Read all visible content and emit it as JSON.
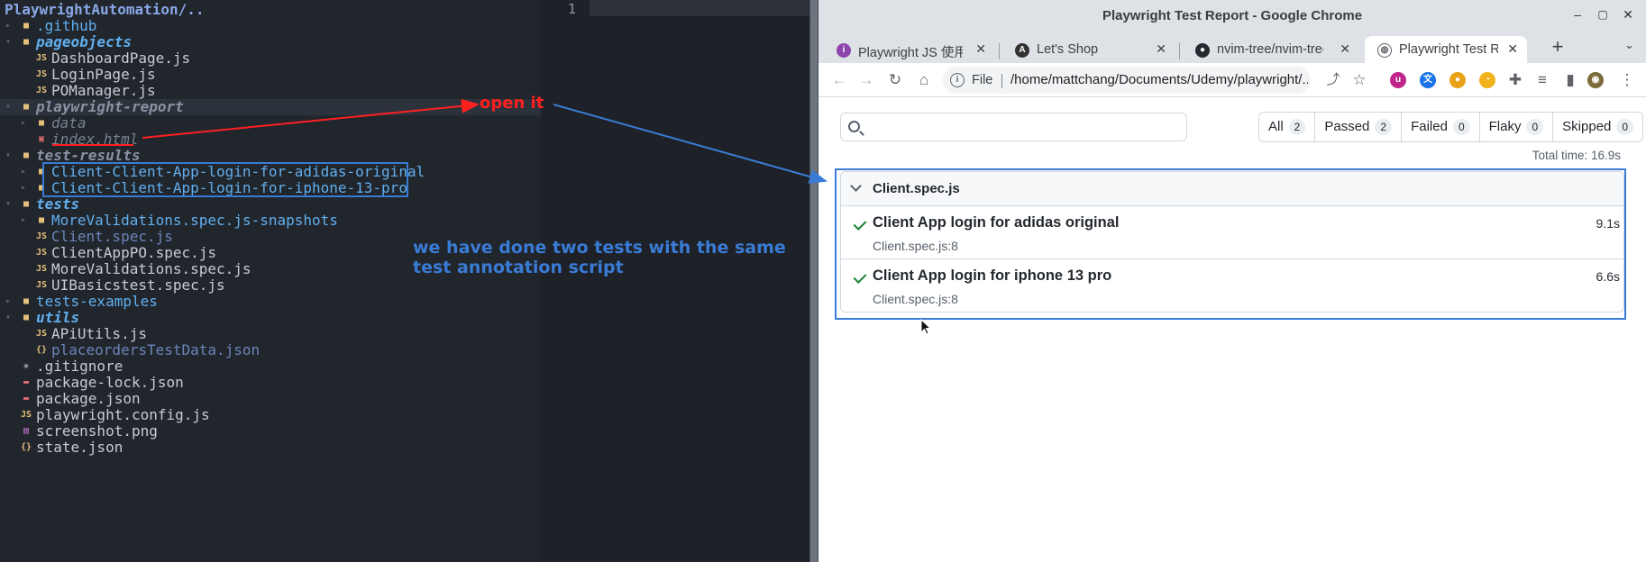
{
  "tree": {
    "root_title": "PlaywrightAutomation/..",
    "rows": [
      {
        "name": ".github",
        "kind": "dir"
      },
      {
        "name": "pageobjects",
        "kind": "opendir"
      },
      {
        "name": "DashboardPage.js",
        "kind": "js"
      },
      {
        "name": "LoginPage.js",
        "kind": "js"
      },
      {
        "name": "POManager.js",
        "kind": "js"
      },
      {
        "name": "playwright-report",
        "kind": "ignored-opendir"
      },
      {
        "name": "data",
        "kind": "ignored-dir"
      },
      {
        "name": "index.html",
        "kind": "ignored-html"
      },
      {
        "name": "test-results",
        "kind": "ignored-opendir"
      },
      {
        "name": "Client-Client-App-login-for-adidas-original",
        "kind": "dir"
      },
      {
        "name": "Client-Client-App-login-for-iphone-13-pro",
        "kind": "dir"
      },
      {
        "name": "tests",
        "kind": "opendir"
      },
      {
        "name": "MoreValidations.spec.js-snapshots",
        "kind": "dir"
      },
      {
        "name": "Client.spec.js",
        "kind": "js-git"
      },
      {
        "name": "ClientAppPO.spec.js",
        "kind": "js"
      },
      {
        "name": "MoreValidations.spec.js",
        "kind": "js"
      },
      {
        "name": "UIBasicstest.spec.js",
        "kind": "js"
      },
      {
        "name": "tests-examples",
        "kind": "dir"
      },
      {
        "name": "utils",
        "kind": "opendir"
      },
      {
        "name": "APiUtils.js",
        "kind": "js"
      },
      {
        "name": "placeordersTestData.json",
        "kind": "json-git"
      },
      {
        "name": ".gitignore",
        "kind": "git"
      },
      {
        "name": "package-lock.json",
        "kind": "npm"
      },
      {
        "name": "package.json",
        "kind": "npm"
      },
      {
        "name": "playwright.config.js",
        "kind": "js"
      },
      {
        "name": "screenshot.png",
        "kind": "img"
      },
      {
        "name": "state.json",
        "kind": "json"
      }
    ]
  },
  "editor": {
    "line_number": "1"
  },
  "browser": {
    "window_title": "Playwright Test Report - Google Chrome",
    "tabs": [
      {
        "title": "Playwright JS 使用",
        "favicon": "purple-circle-icon"
      },
      {
        "title": "Let's Shop",
        "favicon": "angular-icon"
      },
      {
        "title": "nvim-tree/nvim-tree",
        "favicon": "github-icon"
      },
      {
        "title": "Playwright Test Rep",
        "favicon": "globe-icon",
        "active": true
      }
    ],
    "address_scheme": "File",
    "address_url": "/home/mattchang/Documents/Udemy/playwright/..."
  },
  "report": {
    "search_placeholder": "",
    "filters": [
      {
        "label": "All",
        "count": "2"
      },
      {
        "label": "Passed",
        "count": "2"
      },
      {
        "label": "Failed",
        "count": "0"
      },
      {
        "label": "Flaky",
        "count": "0"
      },
      {
        "label": "Skipped",
        "count": "0"
      }
    ],
    "total_time": "Total time: 16.9s",
    "suite": {
      "name": "Client.spec.js",
      "tests": [
        {
          "title": "Client App login for adidas original",
          "location": "Client.spec.js:8",
          "duration": "9.1s"
        },
        {
          "title": "Client App login for iphone 13 pro",
          "location": "Client.spec.js:8",
          "duration": "6.6s"
        }
      ]
    }
  },
  "annotations": {
    "open_it": "open it",
    "note": "we have done two tests with the same test annotation script",
    "colors": {
      "red": "#ff2020",
      "blue": "#3a7bd5"
    }
  }
}
